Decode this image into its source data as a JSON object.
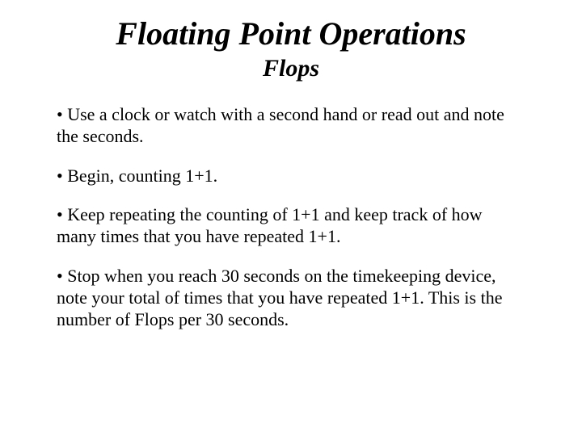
{
  "title": "Floating Point Operations",
  "subtitle": "Flops",
  "bullets": [
    "• Use a clock or watch with a second hand or read out and note the seconds.",
    "• Begin, counting 1+1.",
    "• Keep repeating the counting of 1+1 and keep track of how many times that you have repeated 1+1.",
    "• Stop when you reach 30 seconds on the timekeeping device, note your total of times that you have repeated 1+1. This is the number of Flops per 30 seconds."
  ]
}
